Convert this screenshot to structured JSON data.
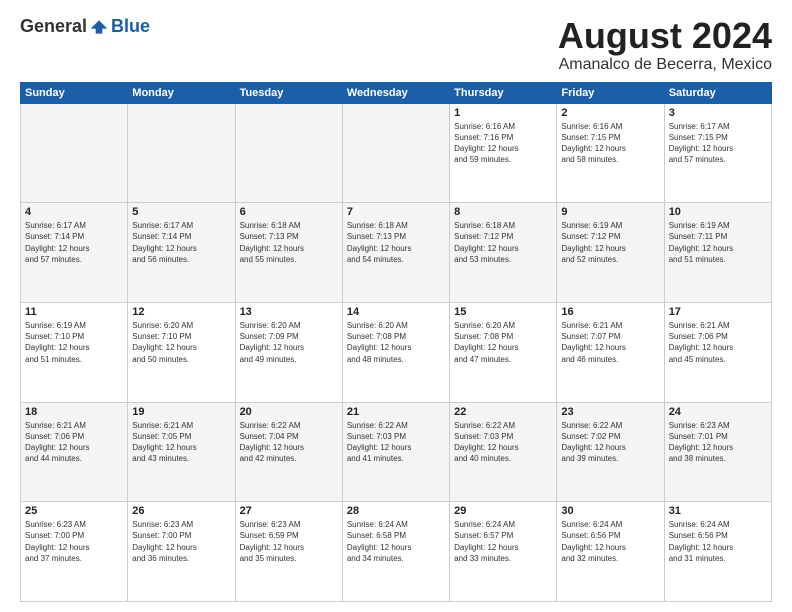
{
  "logo": {
    "general": "General",
    "blue": "Blue"
  },
  "title": "August 2024",
  "location": "Amanalco de Becerra, Mexico",
  "days_of_week": [
    "Sunday",
    "Monday",
    "Tuesday",
    "Wednesday",
    "Thursday",
    "Friday",
    "Saturday"
  ],
  "weeks": [
    [
      {
        "day": "",
        "info": ""
      },
      {
        "day": "",
        "info": ""
      },
      {
        "day": "",
        "info": ""
      },
      {
        "day": "",
        "info": ""
      },
      {
        "day": "1",
        "info": "Sunrise: 6:16 AM\nSunset: 7:16 PM\nDaylight: 12 hours\nand 59 minutes."
      },
      {
        "day": "2",
        "info": "Sunrise: 6:16 AM\nSunset: 7:15 PM\nDaylight: 12 hours\nand 58 minutes."
      },
      {
        "day": "3",
        "info": "Sunrise: 6:17 AM\nSunset: 7:15 PM\nDaylight: 12 hours\nand 57 minutes."
      }
    ],
    [
      {
        "day": "4",
        "info": "Sunrise: 6:17 AM\nSunset: 7:14 PM\nDaylight: 12 hours\nand 57 minutes."
      },
      {
        "day": "5",
        "info": "Sunrise: 6:17 AM\nSunset: 7:14 PM\nDaylight: 12 hours\nand 56 minutes."
      },
      {
        "day": "6",
        "info": "Sunrise: 6:18 AM\nSunset: 7:13 PM\nDaylight: 12 hours\nand 55 minutes."
      },
      {
        "day": "7",
        "info": "Sunrise: 6:18 AM\nSunset: 7:13 PM\nDaylight: 12 hours\nand 54 minutes."
      },
      {
        "day": "8",
        "info": "Sunrise: 6:18 AM\nSunset: 7:12 PM\nDaylight: 12 hours\nand 53 minutes."
      },
      {
        "day": "9",
        "info": "Sunrise: 6:19 AM\nSunset: 7:12 PM\nDaylight: 12 hours\nand 52 minutes."
      },
      {
        "day": "10",
        "info": "Sunrise: 6:19 AM\nSunset: 7:11 PM\nDaylight: 12 hours\nand 51 minutes."
      }
    ],
    [
      {
        "day": "11",
        "info": "Sunrise: 6:19 AM\nSunset: 7:10 PM\nDaylight: 12 hours\nand 51 minutes."
      },
      {
        "day": "12",
        "info": "Sunrise: 6:20 AM\nSunset: 7:10 PM\nDaylight: 12 hours\nand 50 minutes."
      },
      {
        "day": "13",
        "info": "Sunrise: 6:20 AM\nSunset: 7:09 PM\nDaylight: 12 hours\nand 49 minutes."
      },
      {
        "day": "14",
        "info": "Sunrise: 6:20 AM\nSunset: 7:08 PM\nDaylight: 12 hours\nand 48 minutes."
      },
      {
        "day": "15",
        "info": "Sunrise: 6:20 AM\nSunset: 7:08 PM\nDaylight: 12 hours\nand 47 minutes."
      },
      {
        "day": "16",
        "info": "Sunrise: 6:21 AM\nSunset: 7:07 PM\nDaylight: 12 hours\nand 46 minutes."
      },
      {
        "day": "17",
        "info": "Sunrise: 6:21 AM\nSunset: 7:06 PM\nDaylight: 12 hours\nand 45 minutes."
      }
    ],
    [
      {
        "day": "18",
        "info": "Sunrise: 6:21 AM\nSunset: 7:06 PM\nDaylight: 12 hours\nand 44 minutes."
      },
      {
        "day": "19",
        "info": "Sunrise: 6:21 AM\nSunset: 7:05 PM\nDaylight: 12 hours\nand 43 minutes."
      },
      {
        "day": "20",
        "info": "Sunrise: 6:22 AM\nSunset: 7:04 PM\nDaylight: 12 hours\nand 42 minutes."
      },
      {
        "day": "21",
        "info": "Sunrise: 6:22 AM\nSunset: 7:03 PM\nDaylight: 12 hours\nand 41 minutes."
      },
      {
        "day": "22",
        "info": "Sunrise: 6:22 AM\nSunset: 7:03 PM\nDaylight: 12 hours\nand 40 minutes."
      },
      {
        "day": "23",
        "info": "Sunrise: 6:22 AM\nSunset: 7:02 PM\nDaylight: 12 hours\nand 39 minutes."
      },
      {
        "day": "24",
        "info": "Sunrise: 6:23 AM\nSunset: 7:01 PM\nDaylight: 12 hours\nand 38 minutes."
      }
    ],
    [
      {
        "day": "25",
        "info": "Sunrise: 6:23 AM\nSunset: 7:00 PM\nDaylight: 12 hours\nand 37 minutes."
      },
      {
        "day": "26",
        "info": "Sunrise: 6:23 AM\nSunset: 7:00 PM\nDaylight: 12 hours\nand 36 minutes."
      },
      {
        "day": "27",
        "info": "Sunrise: 6:23 AM\nSunset: 6:59 PM\nDaylight: 12 hours\nand 35 minutes."
      },
      {
        "day": "28",
        "info": "Sunrise: 6:24 AM\nSunset: 6:58 PM\nDaylight: 12 hours\nand 34 minutes."
      },
      {
        "day": "29",
        "info": "Sunrise: 6:24 AM\nSunset: 6:57 PM\nDaylight: 12 hours\nand 33 minutes."
      },
      {
        "day": "30",
        "info": "Sunrise: 6:24 AM\nSunset: 6:56 PM\nDaylight: 12 hours\nand 32 minutes."
      },
      {
        "day": "31",
        "info": "Sunrise: 6:24 AM\nSunset: 6:56 PM\nDaylight: 12 hours\nand 31 minutes."
      }
    ]
  ]
}
